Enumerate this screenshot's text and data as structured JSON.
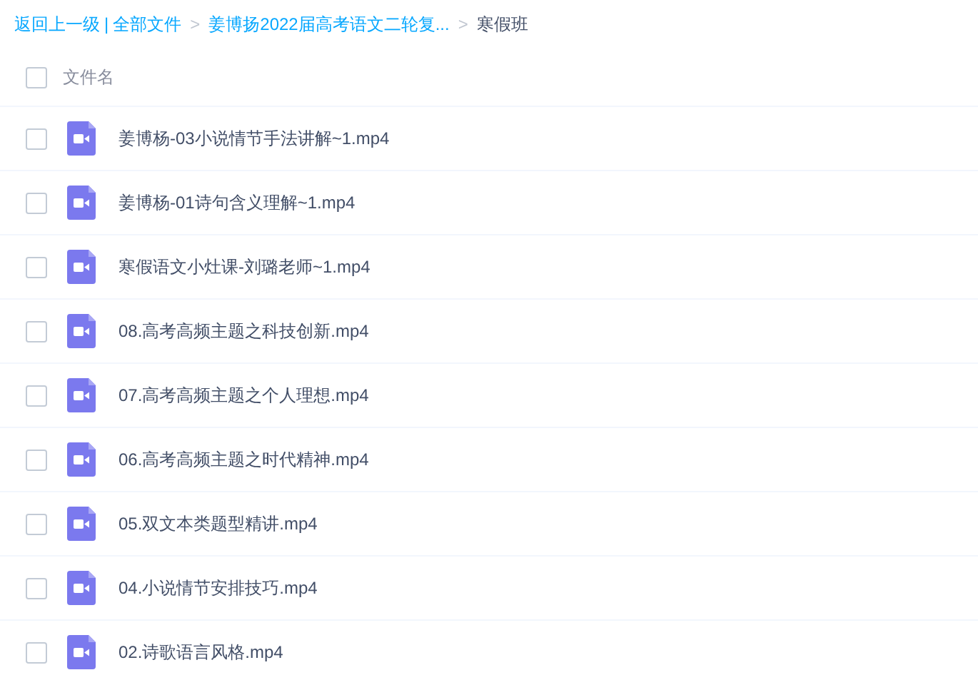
{
  "breadcrumb": {
    "back": "返回上一级",
    "separator": "|",
    "path": [
      {
        "label": "全部文件",
        "current": false
      },
      {
        "label": "姜博扬2022届高考语文二轮复...",
        "current": false
      },
      {
        "label": "寒假班",
        "current": true
      }
    ],
    "arrow": ">"
  },
  "header": {
    "label": "文件名",
    "checked": false
  },
  "files": [
    {
      "name": "姜博杨-03小说情节手法讲解~1.mp4",
      "checked": false
    },
    {
      "name": "姜博杨-01诗句含义理解~1.mp4",
      "checked": false
    },
    {
      "name": "寒假语文小灶课-刘璐老师~1.mp4",
      "checked": false
    },
    {
      "name": "08.高考高频主题之科技创新.mp4",
      "checked": false
    },
    {
      "name": "07.高考高频主题之个人理想.mp4",
      "checked": false
    },
    {
      "name": "06.高考高频主题之时代精神.mp4",
      "checked": false
    },
    {
      "name": "05.双文本类题型精讲.mp4",
      "checked": false
    },
    {
      "name": "04.小说情节安排技巧.mp4",
      "checked": false
    },
    {
      "name": "02.诗歌语言风格.mp4",
      "checked": false
    }
  ]
}
